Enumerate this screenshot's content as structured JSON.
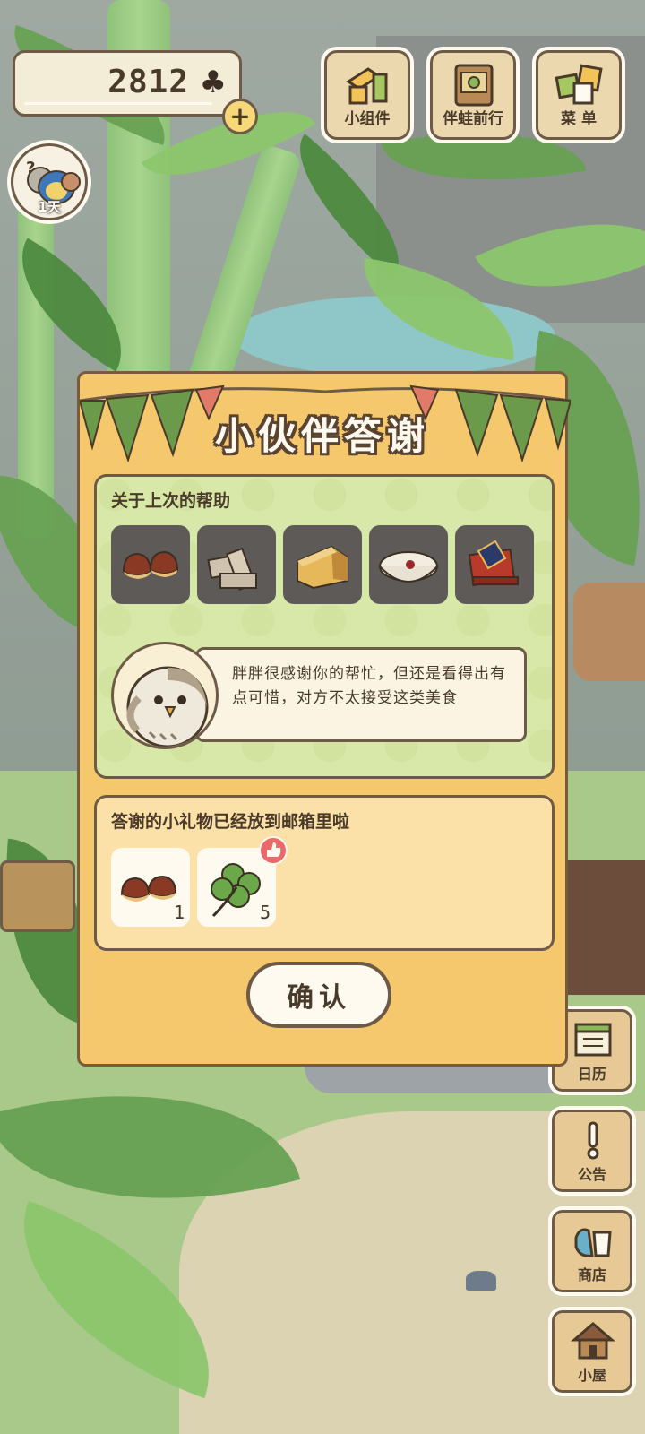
{
  "hud": {
    "clover_count": "2812",
    "clover_icon": "clover-icon",
    "add_label": "+",
    "visitor_days": "1天"
  },
  "top_buttons": [
    {
      "id": "widgets",
      "label": "小组件",
      "icon": "widget-icon"
    },
    {
      "id": "frog-travel",
      "label": "伴蛙前行",
      "icon": "frog-travel-icon"
    },
    {
      "id": "menu",
      "label": "菜 单",
      "icon": "menu-cards-icon"
    }
  ],
  "side_buttons": [
    {
      "id": "calendar",
      "label": "日历",
      "icon": "calendar-icon"
    },
    {
      "id": "notice",
      "label": "公告",
      "icon": "exclamation-icon"
    },
    {
      "id": "shop",
      "label": "商店",
      "icon": "shop-bag-icon"
    },
    {
      "id": "house",
      "label": "小屋",
      "icon": "house-icon"
    }
  ],
  "modal": {
    "title": "小伙伴答谢",
    "section1": {
      "heading": "关于上次的帮助",
      "items": [
        {
          "name": "chestnuts",
          "icon": "chestnut-icon"
        },
        {
          "name": "biscuits",
          "icon": "biscuit-icon"
        },
        {
          "name": "cheese",
          "icon": "cheese-icon"
        },
        {
          "name": "rice-porridge",
          "icon": "porridge-icon"
        },
        {
          "name": "gift-box",
          "icon": "gift-box-icon"
        }
      ],
      "message": "胖胖很感谢你的帮忙，但还是看得出有点可惜，对方不太接受这类美食"
    },
    "section2": {
      "heading": "答谢的小礼物已经放到邮箱里啦",
      "gifts": [
        {
          "name": "chestnuts",
          "icon": "chestnut-icon",
          "qty": "1"
        },
        {
          "name": "clover",
          "icon": "four-leaf-clover-icon",
          "qty": "5",
          "badge": "thumbs-up-icon"
        }
      ]
    },
    "confirm_label": "确认"
  },
  "colors": {
    "modal_bg": "#f6c86e",
    "section1_bg": "#d8e8a8",
    "section2_bg": "#fbe0a8",
    "outline": "#6d5a47",
    "bunting_green": "#6a9a4a",
    "bunting_red": "#e27a6a"
  }
}
